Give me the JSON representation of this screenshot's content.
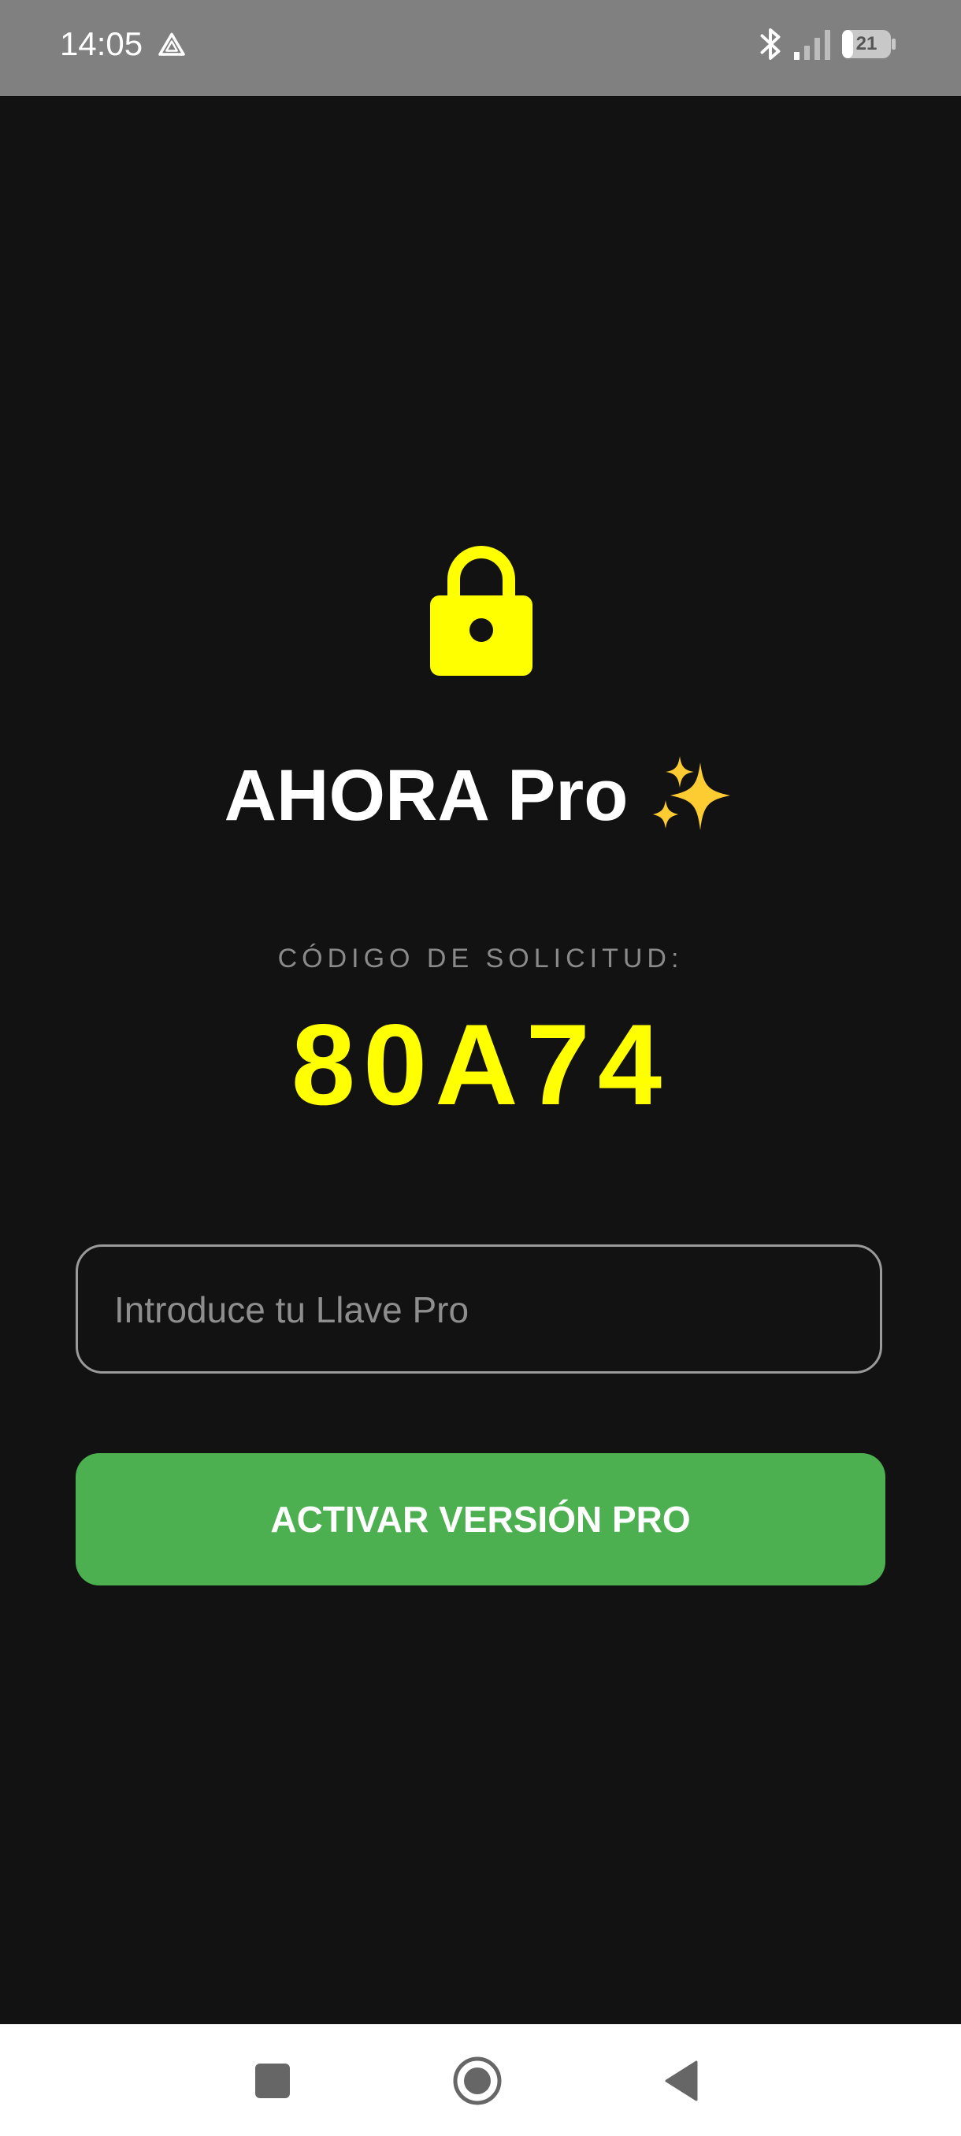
{
  "status_bar": {
    "time": "14:05",
    "battery_level": "21",
    "icons": [
      "drive-icon",
      "bluetooth-icon",
      "signal-icon",
      "battery-icon"
    ]
  },
  "main": {
    "lock_icon": "lock-icon",
    "title": "AHORA Pro",
    "title_emoji": "sparkles-icon",
    "request_label": "CÓDIGO DE SOLICITUD:",
    "request_code": "80A74",
    "key_input": {
      "value": "",
      "placeholder": "Introduce tu Llave Pro"
    },
    "activate_button_label": "ACTIVAR VERSIÓN PRO"
  },
  "nav_bar": {
    "icons": [
      "recents-icon",
      "home-icon",
      "back-icon"
    ]
  },
  "colors": {
    "background": "#121212",
    "status_bar": "#808080",
    "accent_yellow": "#ffff00",
    "button_green": "#4caf50",
    "label_gray": "#8a8a8a",
    "nav_bar": "#ffffff"
  }
}
